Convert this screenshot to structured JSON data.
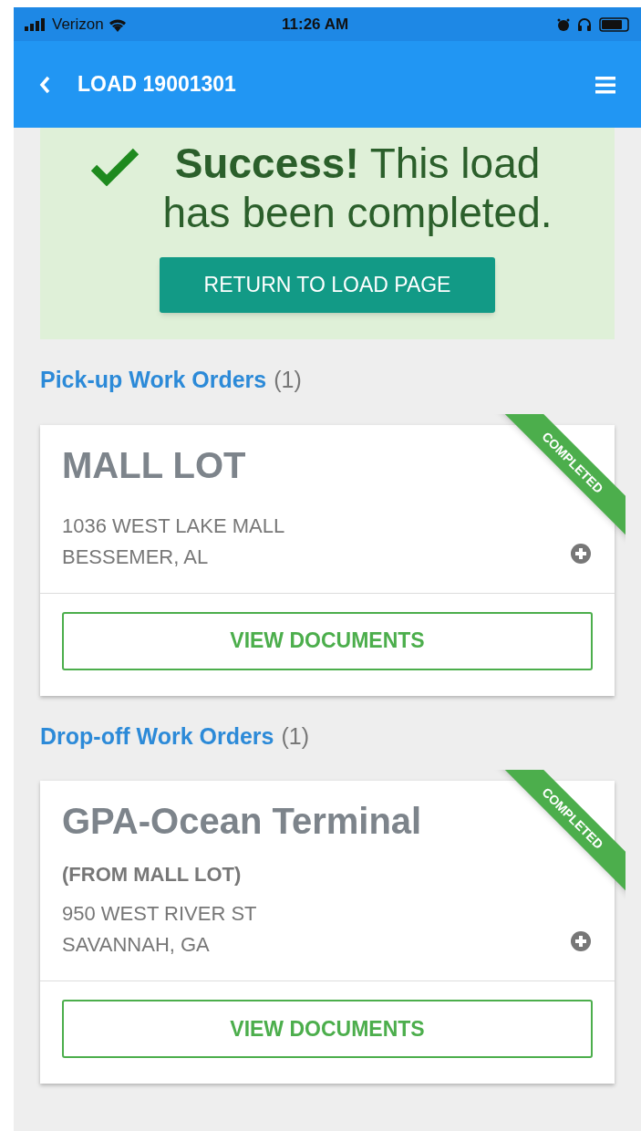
{
  "status_bar": {
    "carrier": "Verizon",
    "time": "11:26 AM"
  },
  "navbar": {
    "title": "LOAD 19001301"
  },
  "alert": {
    "message": "**Success!** This load has been completed.",
    "button": "RETURN TO LOAD PAGE"
  },
  "sections": [
    {
      "title": "Pick-up Work Orders",
      "count": "(1)",
      "cards": [
        {
          "name": "MALL LOT",
          "address": [
            "1036 WEST LAKE MALL",
            "BESSEMER, AL"
          ],
          "ribbon": "COMPLETED",
          "button": "VIEW DOCUMENTS"
        }
      ]
    },
    {
      "title": "Drop-off Work Orders",
      "count": "(1)",
      "cards": [
        {
          "name": "GPA-Ocean Terminal",
          "origin": "(FROM MALL LOT)",
          "address": [
            "950 WEST RIVER ST",
            "SAVANNAH, GA"
          ],
          "ribbon": "COMPLETED",
          "button": "VIEW DOCUMENTS"
        }
      ]
    }
  ]
}
